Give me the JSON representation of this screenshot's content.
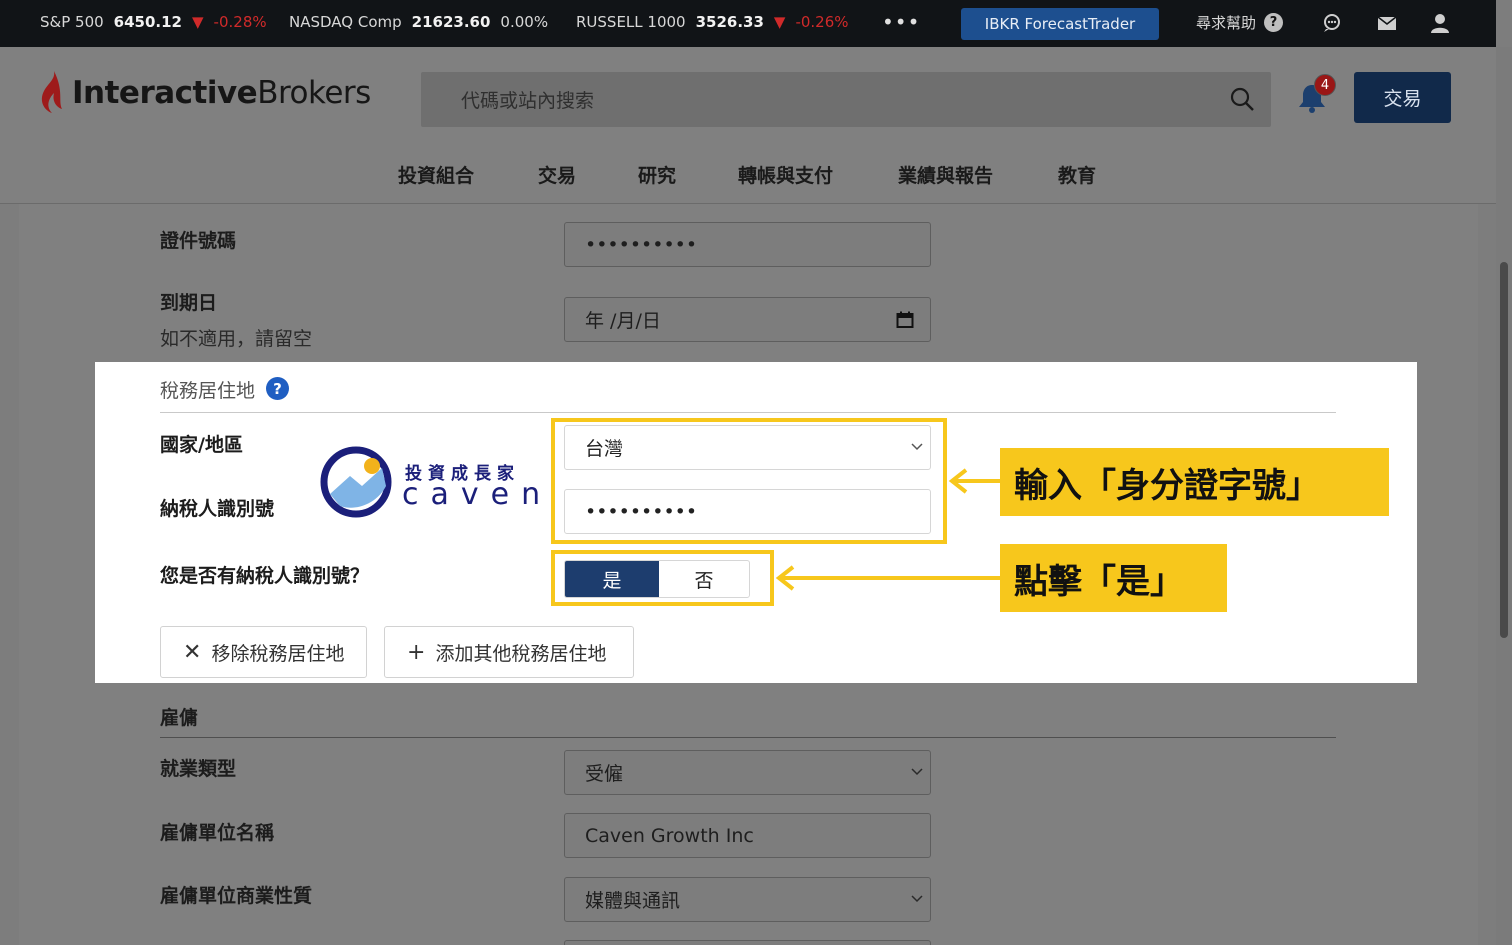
{
  "ticker": [
    {
      "name": "S&P 500",
      "value": "6450.12",
      "arrow": "▼",
      "change": "-0.28%",
      "dir": "neg"
    },
    {
      "name": "NASDAQ Comp",
      "value": "21623.60",
      "arrow": "",
      "change": "0.00%",
      "dir": "flat"
    },
    {
      "name": "RUSSELL 1000",
      "value": "3526.33",
      "arrow": "▼",
      "change": "-0.26%",
      "dir": "neg"
    }
  ],
  "topbar": {
    "more": "•••",
    "forecast_label": "IBKR ForecastTrader",
    "help_label": "尋求幫助",
    "help_icon": "?"
  },
  "header": {
    "logo_bold": "Interactive",
    "logo_regular": "Brokers",
    "search_placeholder": "代碼或站內搜索",
    "notification_count": "4",
    "trade_label": "交易"
  },
  "nav": [
    "投資組合",
    "交易",
    "研究",
    "轉帳與支付",
    "業績與報告",
    "教育"
  ],
  "form": {
    "id_number_label": "證件號碼",
    "id_number_value": "••••••••••",
    "expiry_label": "到期日",
    "expiry_hint": "如不適用，請留空",
    "expiry_value": "年 /月/日",
    "tax_section_title": "稅務居住地",
    "tax_help": "?",
    "country_label": "國家/地區",
    "country_value": "台灣",
    "tin_label": "納稅人識別號",
    "tin_value": "••••••••••",
    "has_tin_question": "您是否有納稅人識別號？",
    "yes_label": "是",
    "no_label": "否",
    "remove_label": "移除稅務居住地",
    "remove_icon": "✕",
    "add_label": "添加其他稅務居住地",
    "add_icon": "+",
    "employment_title": "雇傭",
    "employment_type_label": "就業類型",
    "employment_type_value": "受僱",
    "employer_name_label": "雇傭單位名稱",
    "employer_name_value": "Caven Growth Inc",
    "employer_business_label": "雇傭單位商業性質",
    "employer_business_value": "媒體與通訊"
  },
  "annotations": {
    "callout_tin": "輸入「身分證字號」",
    "callout_yes": "點擊「是」",
    "watermark_zh": "投資成長家",
    "watermark_en": "caven"
  },
  "colors": {
    "highlight": "#f7c71c",
    "toggle_active": "#1d3d6e",
    "trade_button": "#11294a",
    "negative": "#d02a2a"
  }
}
